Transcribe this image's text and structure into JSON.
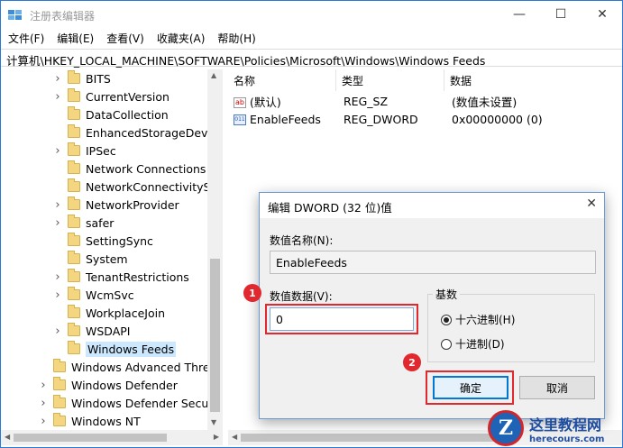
{
  "window": {
    "title": "注册表编辑器",
    "min_glyph": "—",
    "max_glyph": "☐",
    "close_glyph": "✕"
  },
  "menu": [
    "文件(F)",
    "编辑(E)",
    "查看(V)",
    "收藏夹(A)",
    "帮助(H)"
  ],
  "address": "计算机\\HKEY_LOCAL_MACHINE\\SOFTWARE\\Policies\\Microsoft\\Windows\\Windows Feeds",
  "tree": {
    "items": [
      {
        "label": "BITS",
        "expandable": true
      },
      {
        "label": "CurrentVersion",
        "expandable": true
      },
      {
        "label": "DataCollection",
        "expandable": false
      },
      {
        "label": "EnhancedStorageDevice",
        "expandable": false
      },
      {
        "label": "IPSec",
        "expandable": true
      },
      {
        "label": "Network Connections",
        "expandable": false
      },
      {
        "label": "NetworkConnectivitySta",
        "expandable": false
      },
      {
        "label": "NetworkProvider",
        "expandable": true
      },
      {
        "label": "safer",
        "expandable": true
      },
      {
        "label": "SettingSync",
        "expandable": false
      },
      {
        "label": "System",
        "expandable": false
      },
      {
        "label": "TenantRestrictions",
        "expandable": true
      },
      {
        "label": "WcmSvc",
        "expandable": true
      },
      {
        "label": "WorkplaceJoin",
        "expandable": false
      },
      {
        "label": "WSDAPI",
        "expandable": true
      },
      {
        "label": "Windows Feeds",
        "expandable": false,
        "selected": true
      },
      {
        "label": "Windows Advanced Threa",
        "expandable": false
      },
      {
        "label": "Windows Defender",
        "expandable": true
      },
      {
        "label": "Windows Defender Securi",
        "expandable": true
      },
      {
        "label": "Windows NT",
        "expandable": true
      }
    ]
  },
  "list": {
    "headers": [
      "名称",
      "类型",
      "数据"
    ],
    "rows": [
      {
        "icon": "ab",
        "name": "(默认)",
        "type": "REG_SZ",
        "data": "(数值未设置)"
      },
      {
        "icon": "bin",
        "name": "EnableFeeds",
        "type": "REG_DWORD",
        "data": "0x00000000 (0)"
      }
    ]
  },
  "dialog": {
    "title": "编辑 DWORD (32 位)值",
    "name_label": "数值名称(N):",
    "name_value": "EnableFeeds",
    "data_label": "数值数据(V):",
    "data_value": "0",
    "base_label": "基数",
    "radio_hex": "十六进制(H)",
    "radio_dec": "十进制(D)",
    "selected_base": "hex",
    "ok": "确定",
    "cancel": "取消"
  },
  "annotations": {
    "badge1": "1",
    "badge2": "2",
    "color": "#e0282e"
  },
  "watermark": {
    "logo_letter": "Z",
    "text": "这里教程网",
    "url": "herecours.com"
  }
}
